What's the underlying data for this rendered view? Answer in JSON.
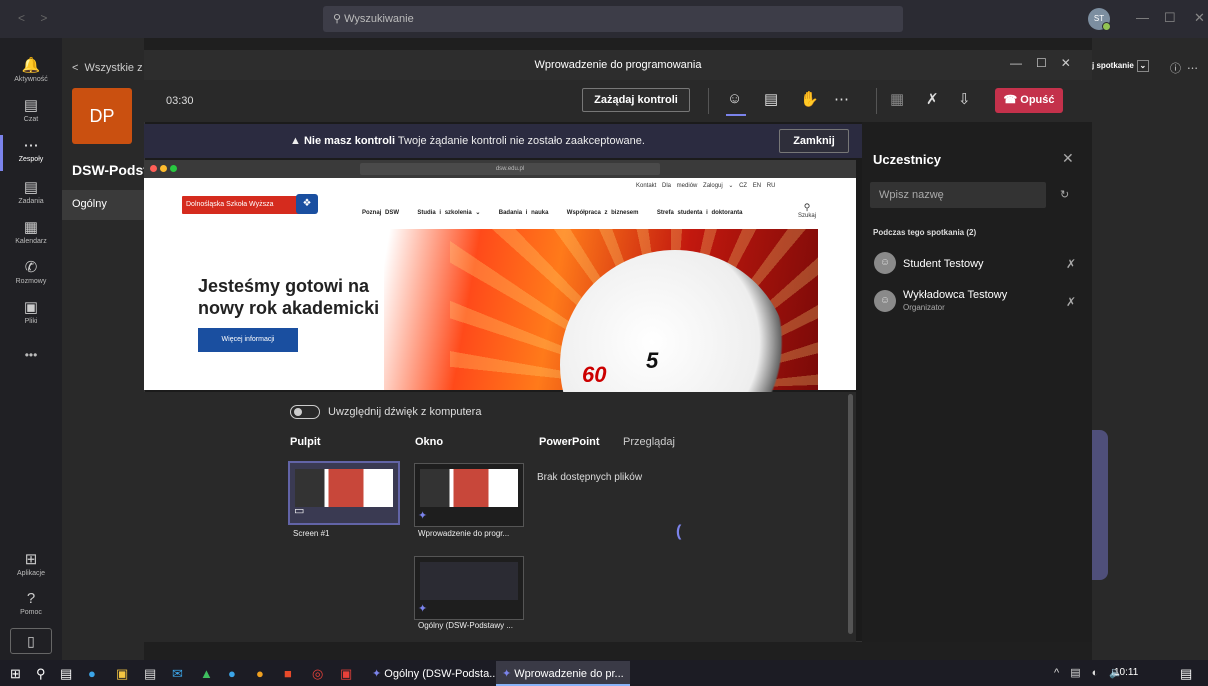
{
  "teams": {
    "search_placeholder": "Wyszukiwanie",
    "avatar_initials": "ST",
    "rail": [
      {
        "label": "Aktywność",
        "icon": "bell-icon"
      },
      {
        "label": "Czat",
        "icon": "chat-icon"
      },
      {
        "label": "Zespoły",
        "icon": "teams-icon"
      },
      {
        "label": "Zadania",
        "icon": "assignments-icon"
      },
      {
        "label": "Kalendarz",
        "icon": "calendar-icon"
      },
      {
        "label": "Rozmowy",
        "icon": "phone-icon"
      },
      {
        "label": "Pliki",
        "icon": "files-icon"
      },
      {
        "label": "•••",
        "icon": "more-icon"
      }
    ],
    "rail_bottom": [
      {
        "label": "Aplikacje",
        "icon": "apps-icon"
      },
      {
        "label": "Pomoc",
        "icon": "help-icon"
      }
    ],
    "back_label": "Wszystkie z",
    "team_badge": "DP",
    "team_name": "DSW-Podst",
    "channel": "Ogólny",
    "right_button": "j spotkanie"
  },
  "meeting": {
    "title": "Wprowadzenie do programowania",
    "timer": "03:30",
    "request_control": "Zażądaj kontroli",
    "leave": "Opuść",
    "banner_bold": "Nie masz kontroli",
    "banner_text": "Twoje żądanie kontroli nie zostało zaakceptowane.",
    "banner_close": "Zamknij"
  },
  "shared_screen": {
    "url": "dsw.edu.pl",
    "top_links": "Kontakt   Dla mediów   Zaloguj ⌄   CZ   EN   RU",
    "logo_text": "Dolnośląska Szkoła Wyższa",
    "nav": [
      "Poznaj DSW",
      "Studia i szkolenia ⌄",
      "Badania i nauka",
      "Współpraca z biznesem",
      "Strefa studenta i doktoranta"
    ],
    "search_label": "Szukaj",
    "headline": "Jesteśmy gotowi na nowy rok akademicki",
    "more_button": "Więcej informacji",
    "watch_num_5": "5",
    "watch_num_60": "60"
  },
  "share_tray": {
    "include_sound": "Uwzględnij dźwięk z komputera",
    "tab_desktop": "Pulpit",
    "tab_window": "Okno",
    "tab_powerpoint": "PowerPoint",
    "tab_browse": "Przeglądaj",
    "no_files": "Brak dostępnych plików",
    "thumbs": [
      {
        "label": "Screen #1"
      },
      {
        "label": "Wprowadzenie do progr..."
      },
      {
        "label": "Ogólny (DSW-Podstawy ..."
      }
    ]
  },
  "participants": {
    "title": "Uczestnicy",
    "search_placeholder": "Wpisz nazwę",
    "group": "Podczas tego spotkania (2)",
    "people": [
      {
        "name": "Student Testowy",
        "role": ""
      },
      {
        "name": "Wykładowca Testowy",
        "role": "Organizator"
      }
    ]
  },
  "taskbar": {
    "apps": [
      {
        "label": "Ogólny (DSW-Podsta..."
      },
      {
        "label": "Wprowadzenie do pr..."
      }
    ],
    "time": "10:11"
  }
}
